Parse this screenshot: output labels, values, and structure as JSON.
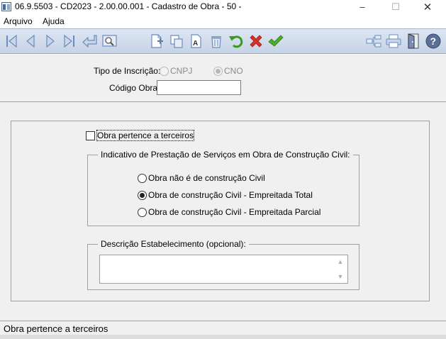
{
  "window": {
    "title": "06.9.5503 - CD2023 - 2.00.00.001 - Cadastro de Obra - 50 -",
    "minimize": "–",
    "maximize": "☐",
    "close": "✕"
  },
  "menu": {
    "items": [
      "Arquivo",
      "Ajuda"
    ]
  },
  "toolbar": {
    "buttons": [
      "first",
      "previous",
      "next",
      "last",
      "enter",
      "search",
      "new",
      "copy",
      "edit-text",
      "delete",
      "undo",
      "cancel",
      "confirm",
      "tree",
      "print",
      "exit",
      "help"
    ]
  },
  "form": {
    "tipo_inscricao_label": "Tipo de Inscrição:",
    "cnpj_label": "CNPJ",
    "cno_label": "CNO",
    "codigo_obra_label": "Código Obra:",
    "codigo_obra_value": "",
    "obra_terceiros_label": "Obra pertence a terceiros",
    "indicativo_title": "Indicativo de Prestação de Serviços em Obra de Construção Civil:",
    "options": [
      "Obra não é de construção Civil",
      "Obra de construção Civil - Empreitada Total",
      "Obra de construção Civil - Empreitada Parcial"
    ],
    "selected_option": 1,
    "descricao_title": "Descrição Estabelecimento (opcional):",
    "descricao_value": ""
  },
  "status": {
    "text": "Obra pertence a terceiros"
  },
  "colors": {
    "toolbar_top": "#dde6f2",
    "toolbar_bottom": "#c6d3e6",
    "icon_blue": "#6a8bbf",
    "undo_green": "#3a9a1e",
    "cancel_red": "#d8302a",
    "confirm_green": "#4caf2a"
  }
}
